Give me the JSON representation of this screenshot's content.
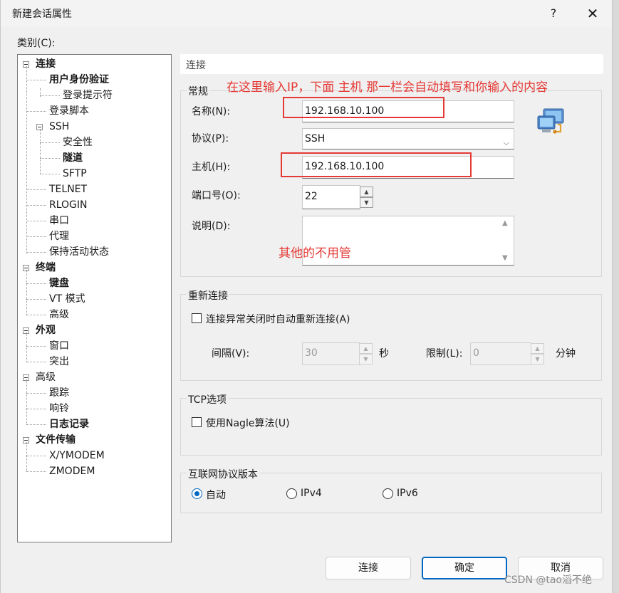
{
  "window": {
    "title": "新建会话属性",
    "help": "?",
    "close": "✕"
  },
  "category_label": "类别(C):",
  "tree": [
    {
      "label": "连接",
      "bold": true
    },
    {
      "label": "用户身份验证",
      "bold": true
    },
    {
      "label": "登录提示符",
      "bold": false
    },
    {
      "label": "登录脚本",
      "bold": false
    },
    {
      "label": "SSH",
      "bold": false
    },
    {
      "label": "安全性",
      "bold": false
    },
    {
      "label": "隧道",
      "bold": true
    },
    {
      "label": "SFTP",
      "bold": false
    },
    {
      "label": "TELNET",
      "bold": false
    },
    {
      "label": "RLOGIN",
      "bold": false
    },
    {
      "label": "串口",
      "bold": false
    },
    {
      "label": "代理",
      "bold": false
    },
    {
      "label": "保持活动状态",
      "bold": false
    },
    {
      "label": "终端",
      "bold": true
    },
    {
      "label": "键盘",
      "bold": true
    },
    {
      "label": "VT 模式",
      "bold": false
    },
    {
      "label": "高级",
      "bold": false
    },
    {
      "label": "外观",
      "bold": true
    },
    {
      "label": "窗口",
      "bold": false
    },
    {
      "label": "突出",
      "bold": false
    },
    {
      "label": "高级",
      "bold": false
    },
    {
      "label": "跟踪",
      "bold": false
    },
    {
      "label": "响铃",
      "bold": false
    },
    {
      "label": "日志记录",
      "bold": true
    },
    {
      "label": "文件传输",
      "bold": true
    },
    {
      "label": "X/YMODEM",
      "bold": false
    },
    {
      "label": "ZMODEM",
      "bold": false
    }
  ],
  "header": "连接",
  "general": {
    "title": "常规",
    "name_label": "名称(N):",
    "name_value": "192.168.10.100",
    "protocol_label": "协议(P):",
    "protocol_value": "SSH",
    "host_label": "主机(H):",
    "host_value": "192.168.10.100",
    "port_label": "端口号(O):",
    "port_value": "22",
    "desc_label": "说明(D):",
    "desc_value": ""
  },
  "reconnect": {
    "title": "重新连接",
    "checkbox_label": "连接异常关闭时自动重新连接(A)",
    "interval_label": "间隔(V):",
    "interval_value": "30",
    "interval_unit": "秒",
    "limit_label": "限制(L):",
    "limit_value": "0",
    "limit_unit": "分钟"
  },
  "tcp": {
    "title": "TCP选项",
    "nagle_label": "使用Nagle算法(U)"
  },
  "ipver": {
    "title": "互联网协议版本",
    "auto": "自动",
    "ipv4": "IPv4",
    "ipv6": "IPv6",
    "selected": "自动"
  },
  "annotations": {
    "top": "在这里输入IP，下面 主机 那一栏会自动填写和你输入的内容",
    "middle": "其他的不用管",
    "color": "#e53935"
  },
  "buttons": {
    "connect": "连接",
    "ok": "确定",
    "cancel": "取消"
  },
  "watermark": "CSDN @tao滔不绝",
  "colors": {
    "accent": "#0067c0",
    "annotation": "#e53935"
  }
}
